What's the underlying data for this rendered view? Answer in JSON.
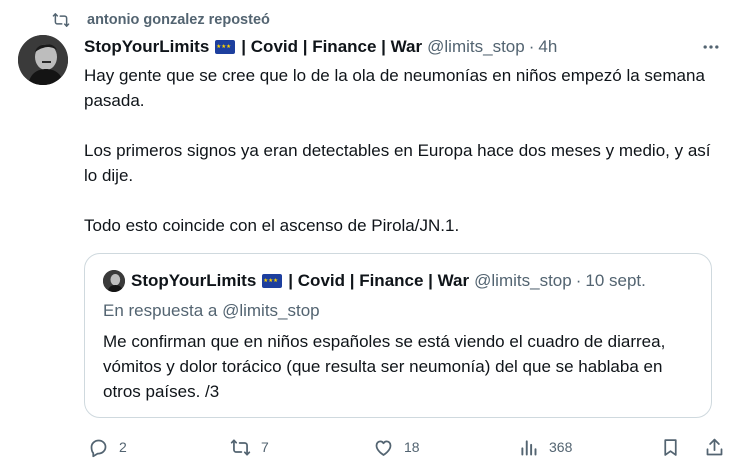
{
  "repost": {
    "label": "antonio gonzalez reposteó"
  },
  "tweet": {
    "display_name": "StopYourLimits",
    "name_suffix": "| Covid | Finance | War",
    "handle": "@limits_stop",
    "separator": "·",
    "time": "4h",
    "paragraphs": [
      "Hay gente que se cree que lo de la ola de neumonías en niños empezó la semana pasada.",
      "Los primeros signos ya eran detectables en Europa hace dos meses y medio, y así lo dije.",
      "Todo esto coincide con el ascenso de Pirola/JN.1."
    ]
  },
  "quote": {
    "display_name": "StopYourLimits",
    "name_suffix": "| Covid | Finance | War",
    "handle": "@limits_stop",
    "separator": "·",
    "time": "10 sept.",
    "reply_to": "En respuesta a @limits_stop",
    "text": "Me confirman que en niños españoles se está viendo el cuadro de diarrea, vómitos y dolor torácico (que resulta ser neumonía) del que se hablaba en otros países. /3"
  },
  "actions": {
    "replies": "2",
    "reposts": "7",
    "likes": "18",
    "views": "368"
  },
  "icons": [
    "repost-icon",
    "more-icon",
    "reply-icon",
    "like-icon",
    "views-icon",
    "bookmark-icon",
    "share-icon",
    "eu-flag-icon"
  ],
  "colors": {
    "text": "#0f1419",
    "secondary": "#536471",
    "border": "#cfd9de",
    "flag": "#1d3f9e"
  }
}
